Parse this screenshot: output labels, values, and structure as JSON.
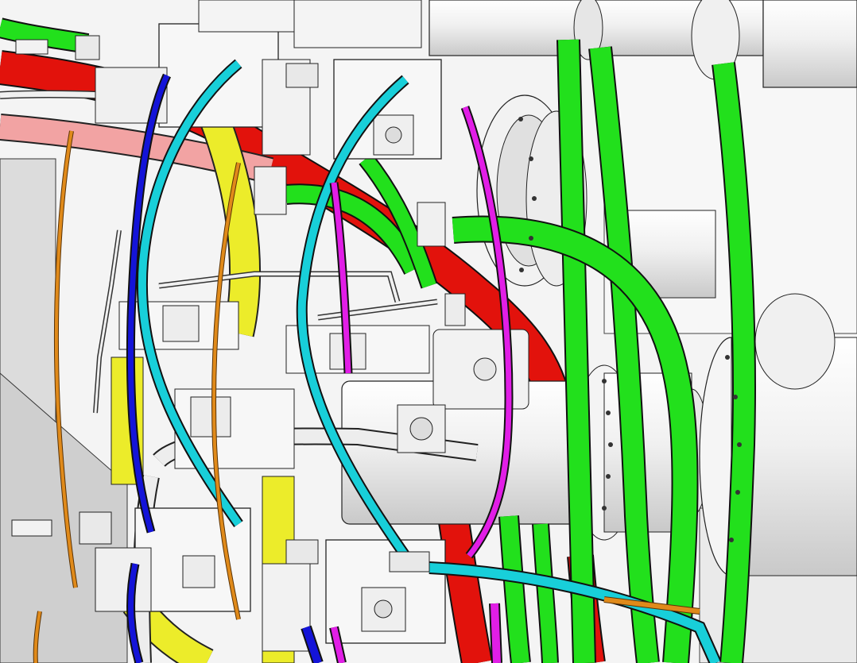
{
  "colors": {
    "background": "#f4f4f4",
    "metal_light": "#f6f6f6",
    "metal_mid": "#d8d8d8",
    "metal_dark": "#9a9a9a",
    "outline": "#1a1a1a",
    "green_hose": "#22e01c",
    "red_hose": "#e2120c",
    "pink_hose": "#f2a3a3",
    "cyan_hose": "#18cfd9",
    "blue_hose": "#1414d8",
    "magenta_hose": "#e11ee6",
    "orange_tube": "#e08a1a",
    "yellow_part": "#ecec2a",
    "white_tube": "#e9e9e9"
  },
  "scene": {
    "description_label": "",
    "view": "3d-cad-assembly"
  }
}
